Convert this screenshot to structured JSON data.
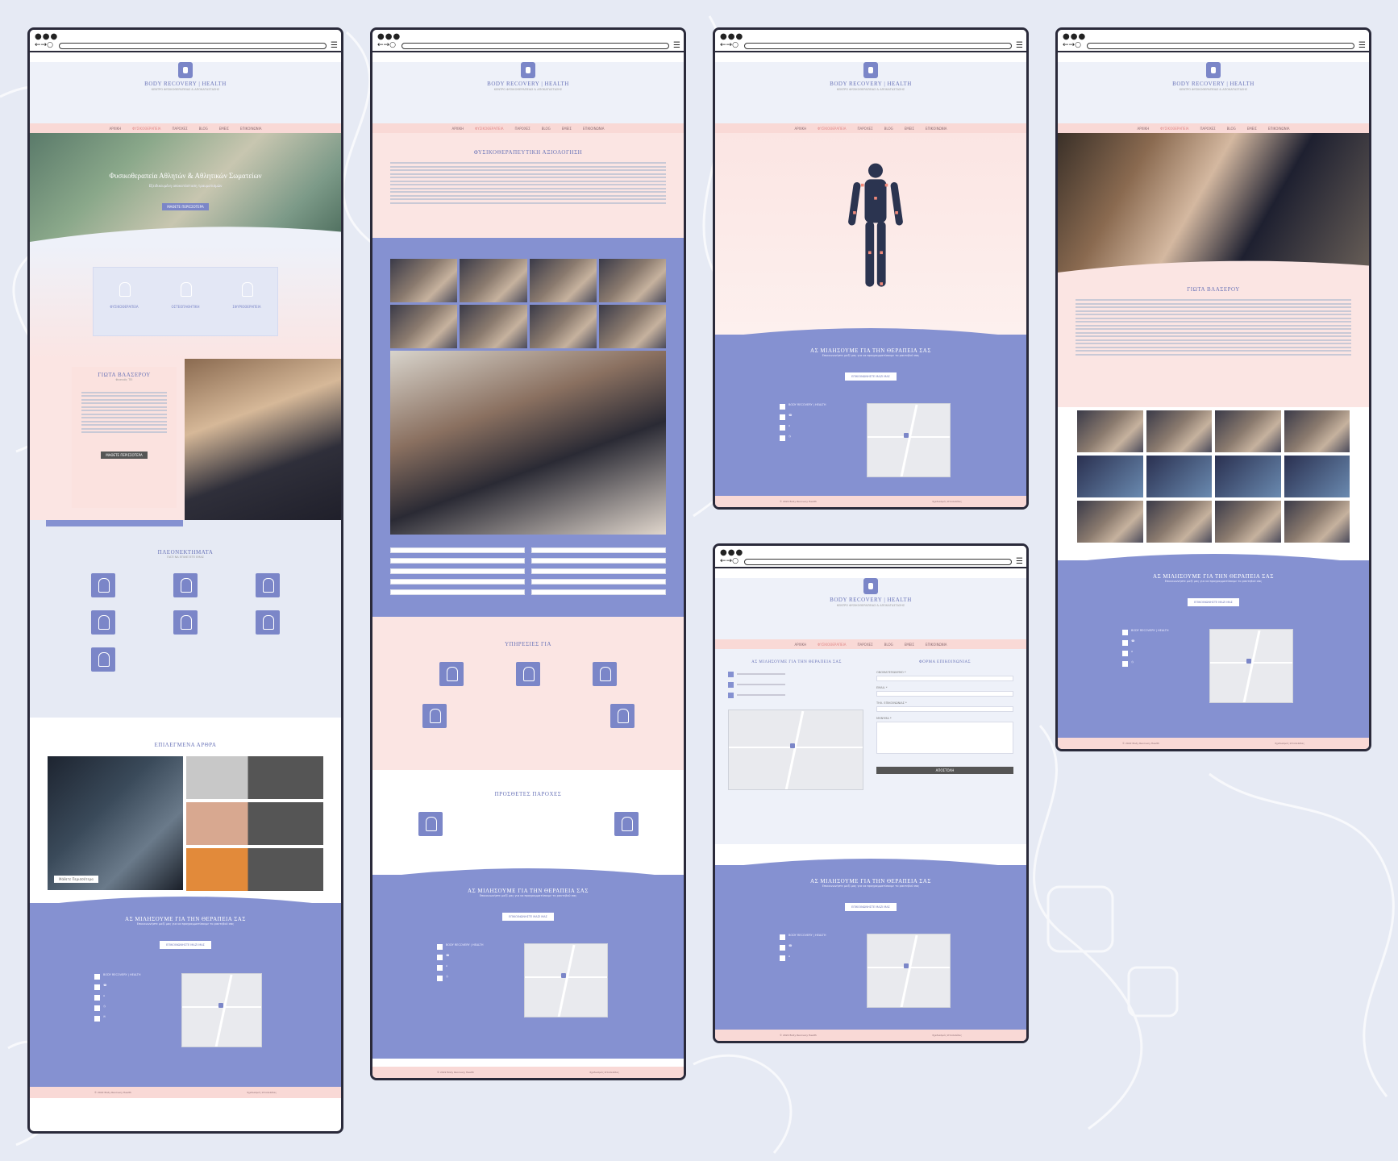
{
  "brand": {
    "name": "BODY RECOVERY | HEALTH",
    "tagline": "ΚΕΝΤΡΟ ΦΥΣΙΚΟΘΕΡΑΠΕΙΑΣ & ΑΠΟΚΑΤΑΣΤΑΣΗΣ"
  },
  "nav": {
    "items": [
      "ΑΡΧΙΚΗ",
      "ΦΥΣΙΚΟΘΕΡΑΠΕΙΑ",
      "ΠΑΡΟΧΕΣ",
      "BLOG",
      "ΕΜΕΙΣ",
      "ΕΠΙΚΟΙΝΩΝΙΑ"
    ]
  },
  "home": {
    "hero_title": "Φυσικοθεραπεία Αθλητών & Αθλητικών Σωματείων",
    "hero_sub": "Εξειδικευμένη αποκατάσταση τραυματισμών",
    "hero_button": "ΜΑΘΕΤΕ ΠΕΡΙΣΣΟΤΕΡΑ",
    "services": [
      {
        "label": "ΦΥΣΙΚΟΘΕΡΑΠΕΙΑ",
        "icon": "physio-icon"
      },
      {
        "label": "ΟΣΤΕΟΠΑΘΗΤΙΚΗ",
        "icon": "spine-icon"
      },
      {
        "label": "ΣΦΥΡΙΟΘΕΡΑΠΕΙΑ",
        "icon": "runner-icon"
      }
    ],
    "therapist_name": "ΓΙΩΤΑ ΒΛΑΣΕΡΟΥ",
    "therapist_role": "Φυσικός ΤΕΙ",
    "about_button": "ΜΑΘΕΤΕ ΠΕΡΙΣΣΟΤΕΡΑ",
    "advantages_title": "ΠΛΕΟΝΕΚΤΗΜΑΤΑ",
    "advantages_sub": "ΓΙΑΤΙ ΝΑ ΕΠΙΛΕΞΕΤΕ ΕΜΑΣ",
    "articles_title": "ΕΠΙΛΕΓΜΕΝΑ ΑΡΘΡΑ",
    "read_more": "Μάθετε Περισσότερα"
  },
  "assessment": {
    "title": "ΦΥΣΙΚΟΘΕΡΑΠΕΥΤΙΚΗ ΑΞΙΟΛΟΓΗΣΗ",
    "services_title": "ΥΠΗΡΕΣΙΕΣ ΓΙΑ",
    "extra_title": "ΠΡΟΣΘΕΤΕΣ ΠΑΡΟΧΕΣ"
  },
  "contact": {
    "title": "ΑΣ ΜΙΛΗΣΟΥΜΕ ΓΙΑ ΤΗΝ ΘΕΡΑΠΕΙΑ ΣΑΣ",
    "sub": "Επικοινωνήστε μαζί μας για να προγραμματίσουμε το ραντεβού σας",
    "button": "ΕΠΙΚΟΙΝΩΝΗΣΤΕ ΜΑΖΙ ΜΑΣ",
    "form_title": "ΦΟΡΜΑ ΕΠΙΚΟΙΝΩΝΙΑΣ",
    "form_button": "ΑΠΟΣΤΟΛΗ",
    "labels": [
      "ΟΝΟΜΑΤΕΠΩΝΥΜΟ *",
      "EMAIL *",
      "ΤΗΛ. ΕΠΙΚΟΙΝΩΝΙΑΣ *",
      "ΜΗΝΥΜΑ *"
    ]
  },
  "about": {
    "name": "ΓΙΩΤΑ ΒΛΑΣΕΡΟΥ"
  },
  "footer": {
    "left": "© 2022 Body Recovery Health",
    "right": "Σχεδιασμός Ιστοσελίδας"
  },
  "colors": {
    "accent": "#8591d1",
    "pink": "#f9d9d6",
    "background": "#e6eaf4"
  }
}
